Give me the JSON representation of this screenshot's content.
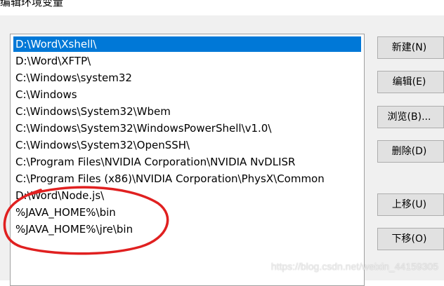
{
  "window": {
    "title": "编辑环境变量"
  },
  "path_list": {
    "items": [
      {
        "label": "D:\\Word\\Xshell\\",
        "selected": true
      },
      {
        "label": "D:\\Word\\XFTP\\",
        "selected": false
      },
      {
        "label": "C:\\Windows\\system32",
        "selected": false
      },
      {
        "label": "C:\\Windows",
        "selected": false
      },
      {
        "label": "C:\\Windows\\System32\\Wbem",
        "selected": false
      },
      {
        "label": "C:\\Windows\\System32\\WindowsPowerShell\\v1.0\\",
        "selected": false
      },
      {
        "label": "C:\\Windows\\System32\\OpenSSH\\",
        "selected": false
      },
      {
        "label": "C:\\Program Files\\NVIDIA Corporation\\NVIDIA NvDLISR",
        "selected": false
      },
      {
        "label": "C:\\Program Files (x86)\\NVIDIA Corporation\\PhysX\\Common",
        "selected": false
      },
      {
        "label": "D:\\Word\\Node.js\\",
        "selected": false
      },
      {
        "label": "%JAVA_HOME%\\bin",
        "selected": false
      },
      {
        "label": "%JAVA_HOME%\\jre\\bin",
        "selected": false
      }
    ]
  },
  "buttons": {
    "new_label": "新建(N)",
    "edit_label": "编辑(E)",
    "browse_label": "浏览(B)...",
    "delete_label": "删除(D)",
    "move_up_label": "上移(U)",
    "move_down_label": "下移(O)"
  },
  "annotation": {
    "color": "#e02020",
    "shape": "hand-drawn-circle"
  },
  "watermark": {
    "text": "https://blog.csdn.net/weixin_44159305"
  },
  "colors": {
    "selection": "#0078d7",
    "dialog_background": "#f0f0f0",
    "button_face": "#e1e1e1"
  }
}
